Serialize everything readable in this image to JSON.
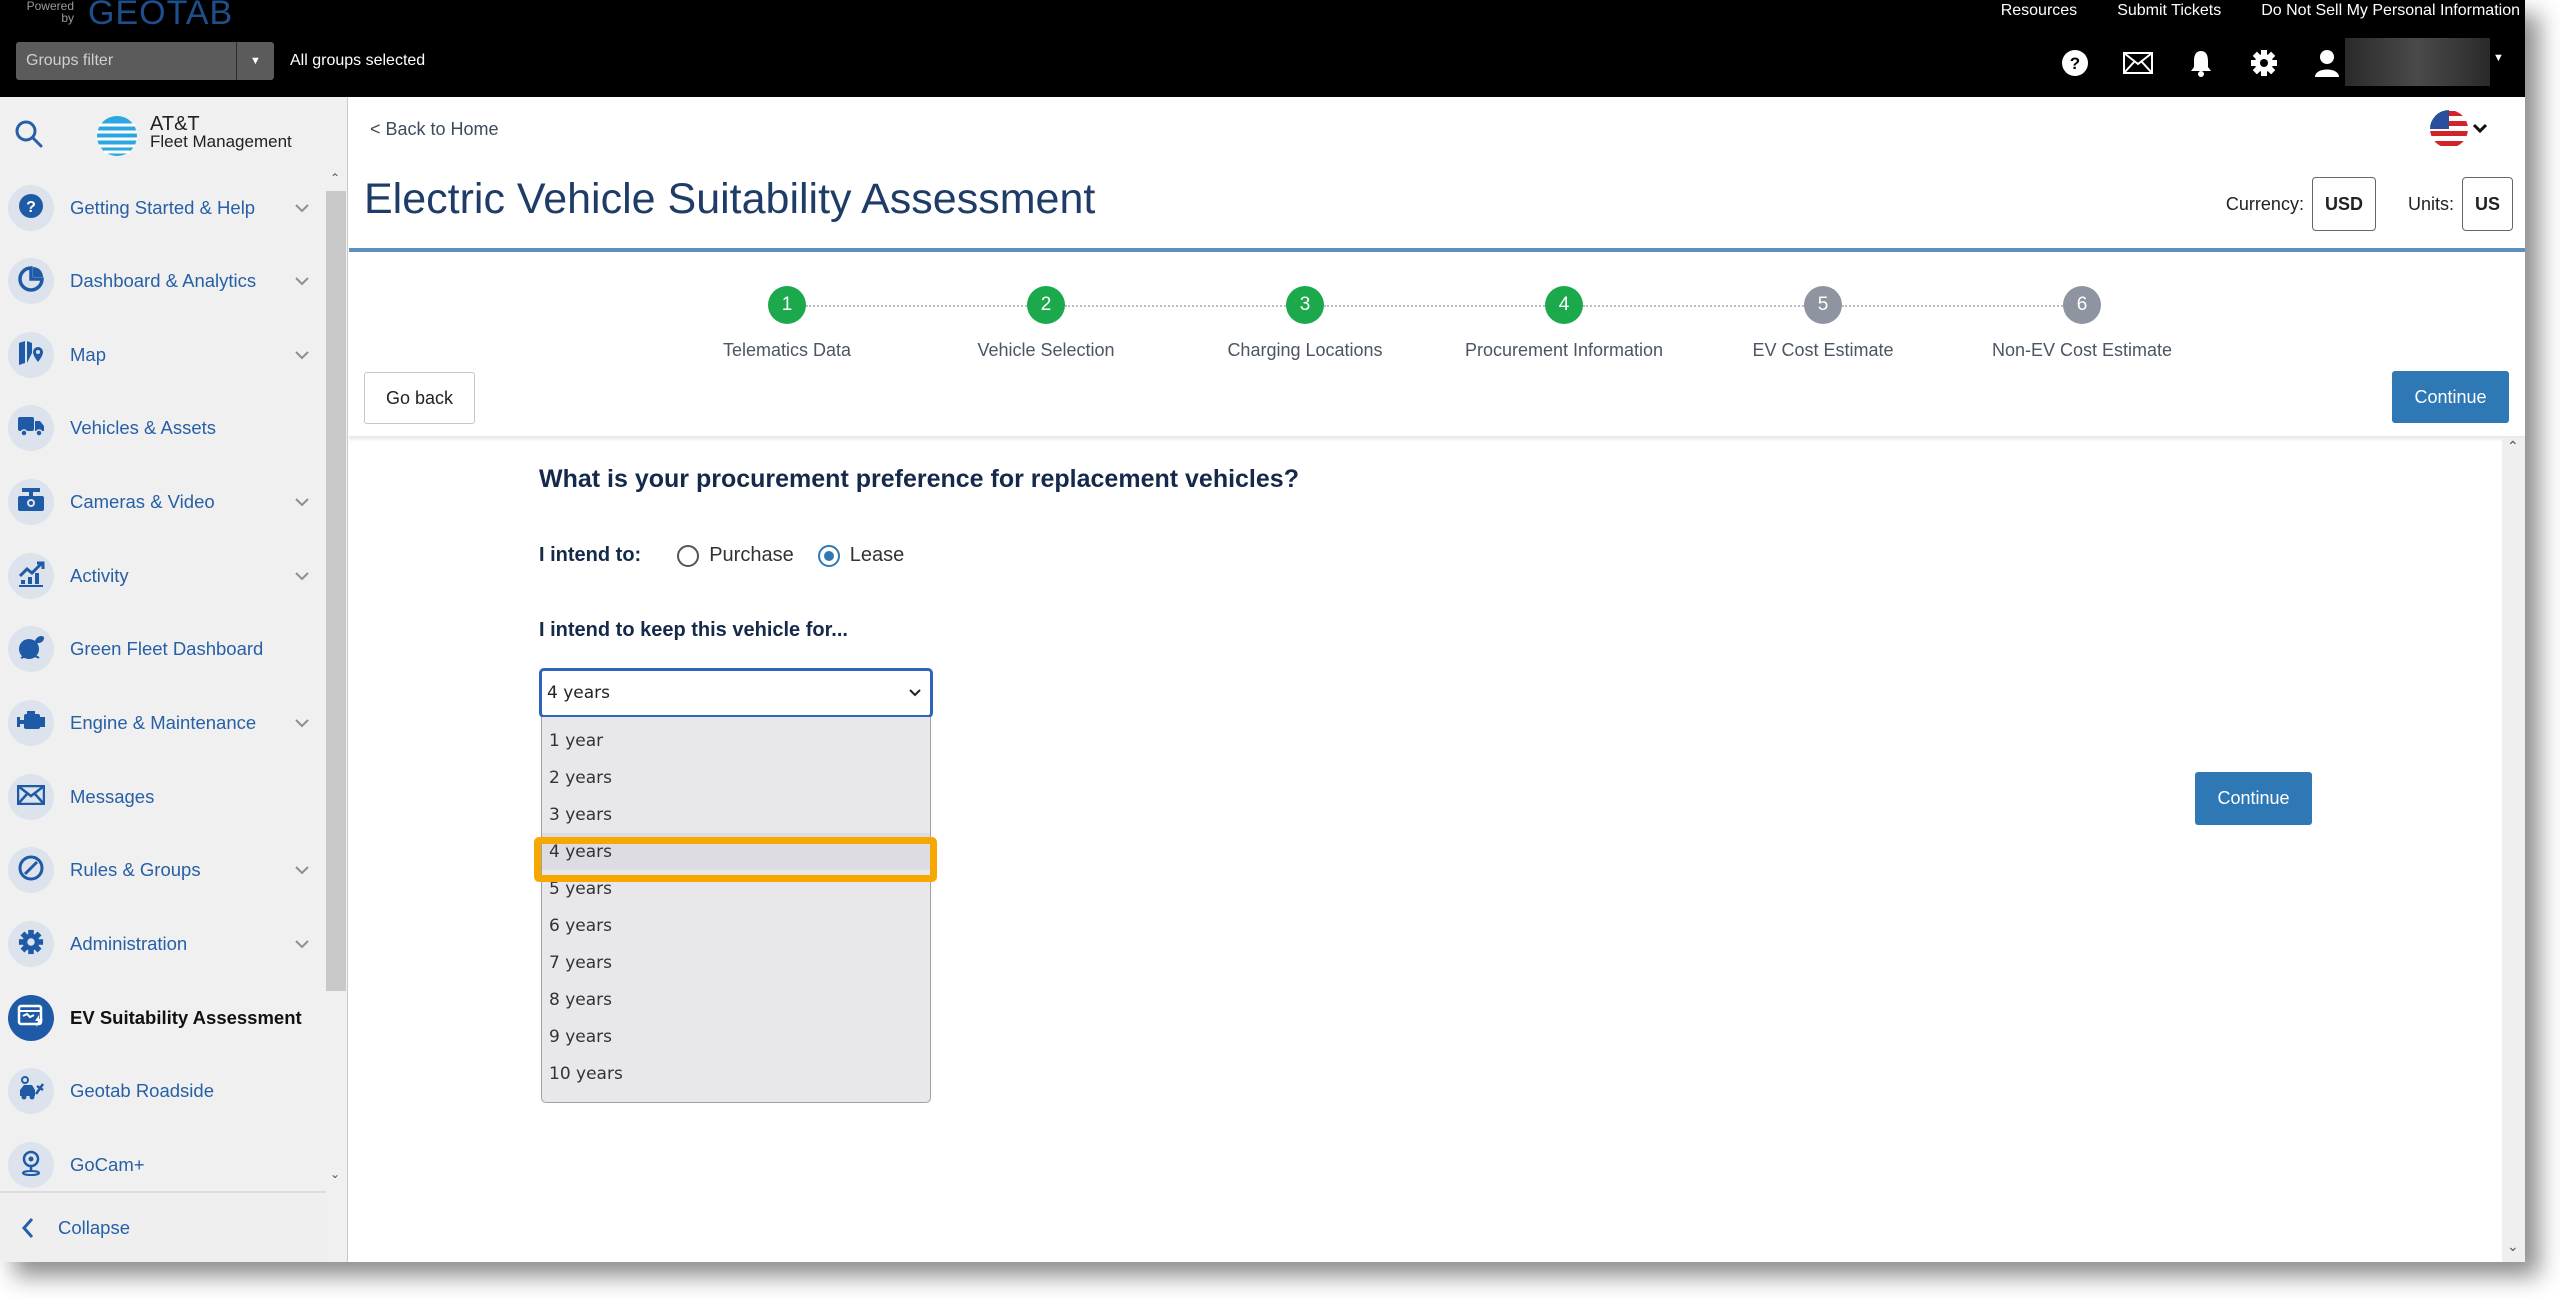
{
  "header": {
    "powered_by": "Powered by",
    "brand": "GEOTAB",
    "groups_filter_placeholder": "Groups filter",
    "groups_status": "All groups selected",
    "links": [
      "Resources",
      "Submit Tickets",
      "Do Not Sell My Personal Information"
    ],
    "icons": [
      "help-icon",
      "mail-icon",
      "bell-icon",
      "gear-icon",
      "user-icon"
    ]
  },
  "sidebar": {
    "logo_line1": "AT&T",
    "logo_line2": "Fleet Management",
    "items": [
      {
        "label": "Getting Started & Help",
        "icon": "help-icon",
        "expandable": true
      },
      {
        "label": "Dashboard & Analytics",
        "icon": "pie-chart-icon",
        "expandable": true
      },
      {
        "label": "Map",
        "icon": "map-icon",
        "expandable": true
      },
      {
        "label": "Vehicles & Assets",
        "icon": "truck-icon",
        "expandable": false
      },
      {
        "label": "Cameras & Video",
        "icon": "camera-icon",
        "expandable": true
      },
      {
        "label": "Activity",
        "icon": "activity-chart-icon",
        "expandable": true
      },
      {
        "label": "Green Fleet Dashboard",
        "icon": "green-fleet-icon",
        "expandable": false
      },
      {
        "label": "Engine & Maintenance",
        "icon": "engine-icon",
        "expandable": true
      },
      {
        "label": "Messages",
        "icon": "mail-icon",
        "expandable": false
      },
      {
        "label": "Rules & Groups",
        "icon": "rules-icon",
        "expandable": true
      },
      {
        "label": "Administration",
        "icon": "gear-icon",
        "expandable": true
      },
      {
        "label": "EV Suitability Assessment",
        "icon": "ev-assessment-icon",
        "expandable": false,
        "active": true
      },
      {
        "label": "Geotab Roadside",
        "icon": "roadside-icon",
        "expandable": false
      },
      {
        "label": "GoCam+",
        "icon": "gocam-icon",
        "expandable": false
      }
    ],
    "collapse_label": "Collapse"
  },
  "main": {
    "back_link": "< Back to Home",
    "title": "Electric Vehicle Suitability Assessment",
    "currency_label": "Currency:",
    "currency_value": "USD",
    "units_label": "Units:",
    "units_value": "US",
    "steps": [
      {
        "number": "1",
        "label": "Telematics Data",
        "status": "done"
      },
      {
        "number": "2",
        "label": "Vehicle Selection",
        "status": "done"
      },
      {
        "number": "3",
        "label": "Charging Locations",
        "status": "done"
      },
      {
        "number": "4",
        "label": "Procurement Information",
        "status": "current"
      },
      {
        "number": "5",
        "label": "EV Cost Estimate",
        "status": "todo"
      },
      {
        "number": "6",
        "label": "Non-EV Cost Estimate",
        "status": "todo"
      }
    ],
    "go_back_label": "Go back",
    "continue_label": "Continue",
    "question": "What is your procurement preference for replacement vehicles?",
    "intend_label": "I intend to:",
    "radio_options": [
      {
        "label": "Purchase",
        "checked": false
      },
      {
        "label": "Lease",
        "checked": true
      }
    ],
    "keep_label": "I intend to keep this vehicle for...",
    "keep_select": {
      "value": "4 years",
      "options": [
        "1 year",
        "2 years",
        "3 years",
        "4 years",
        "5 years",
        "6 years",
        "7 years",
        "8 years",
        "9 years",
        "10 years"
      ],
      "highlighted_index": 3
    }
  },
  "colors": {
    "accent_blue": "#2f78b6",
    "step_done": "#1ba94c",
    "step_todo": "#8e94a0",
    "highlight": "#f7a800",
    "title": "#1f3c68"
  }
}
